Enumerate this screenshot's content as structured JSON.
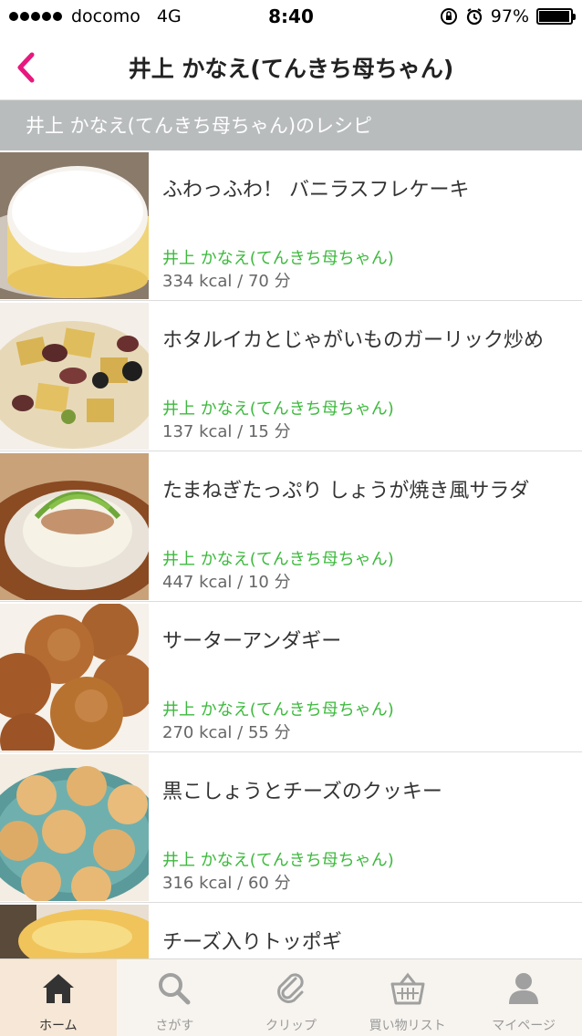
{
  "status_bar": {
    "carrier": "docomo",
    "network": "4G",
    "time": "8:40",
    "battery": "97%",
    "battery_level": 0.97
  },
  "nav": {
    "title": "井上 かなえ(てんきち母ちゃん)",
    "back_icon": "chevron-left-icon",
    "accent_color": "#e5197e"
  },
  "section": {
    "title": "井上 かなえ(てんきち母ちゃん)のレシピ"
  },
  "recipes": [
    {
      "title": "ふわっふわ！ バニラスフレケーキ",
      "author": "井上 かなえ(てんきち母ちゃん)",
      "meta": "334 kcal / 70 分"
    },
    {
      "title": "ホタルイカとじゃがいものガーリック炒め",
      "author": "井上 かなえ(てんきち母ちゃん)",
      "meta": "137 kcal / 15 分"
    },
    {
      "title": "たまねぎたっぷり しょうが焼き風サラダ",
      "author": "井上 かなえ(てんきち母ちゃん)",
      "meta": "447 kcal / 10 分"
    },
    {
      "title": "サーターアンダギー",
      "author": "井上 かなえ(てんきち母ちゃん)",
      "meta": "270 kcal / 55 分"
    },
    {
      "title": "黒こしょうとチーズのクッキー",
      "author": "井上 かなえ(てんきち母ちゃん)",
      "meta": "316 kcal / 60 分"
    },
    {
      "title": "チーズ入りトッポギ",
      "author": "",
      "meta": ""
    }
  ],
  "tabs": [
    {
      "label": "ホーム",
      "icon": "home-icon",
      "active": true
    },
    {
      "label": "さがす",
      "icon": "search-icon",
      "active": false
    },
    {
      "label": "クリップ",
      "icon": "paperclip-icon",
      "active": false
    },
    {
      "label": "買い物リスト",
      "icon": "basket-icon",
      "active": false
    },
    {
      "label": "マイページ",
      "icon": "person-icon",
      "active": false
    }
  ],
  "colors": {
    "author_green": "#3dba3d",
    "section_gray": "#b9bcbd",
    "tab_bg": "#f7f4ef",
    "active_tab_bg": "#f6e7d6"
  }
}
